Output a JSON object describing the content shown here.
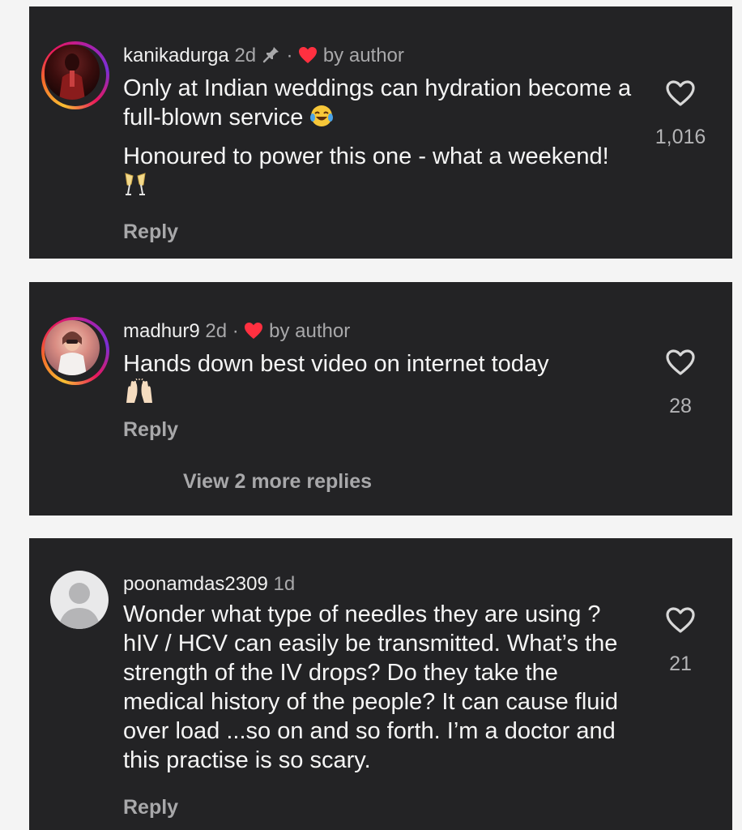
{
  "comments": [
    {
      "username": "kanikadurga",
      "time": "2d",
      "pinned": true,
      "liked_by_author": true,
      "by_author_label": "by author",
      "lines": [
        "Only at Indian weddings can hydration become a full-blown service",
        "Honoured to power this one - what a weekend!"
      ],
      "emojis": [
        "face-with-tears-of-joy",
        "clinking-glasses"
      ],
      "reply_label": "Reply",
      "like_count": "1,016"
    },
    {
      "username": "madhur9",
      "time": "2d",
      "pinned": false,
      "liked_by_author": true,
      "by_author_label": "by author",
      "lines": [
        "Hands down best video on internet today"
      ],
      "emojis": [
        "raising-hands"
      ],
      "reply_label": "Reply",
      "view_replies_label": "View 2 more replies",
      "like_count": "28"
    },
    {
      "username": "poonamdas2309",
      "time": "1d",
      "pinned": false,
      "liked_by_author": false,
      "lines": [
        "Wonder what type of needles they are using ? hIV / HCV can easily be transmitted. What’s the strength of the IV drops? Do they take the medical history of the people? It can cause fluid over load ...so on and so forth. I’m a doctor and this practise is so scary."
      ],
      "reply_label": "Reply",
      "like_count": "21"
    }
  ],
  "colors": {
    "background": "#f4f4f4",
    "card": "#232325",
    "text_primary": "#f5f5f5",
    "text_secondary": "#a8a8aa",
    "author_heart": "#ff3040"
  }
}
